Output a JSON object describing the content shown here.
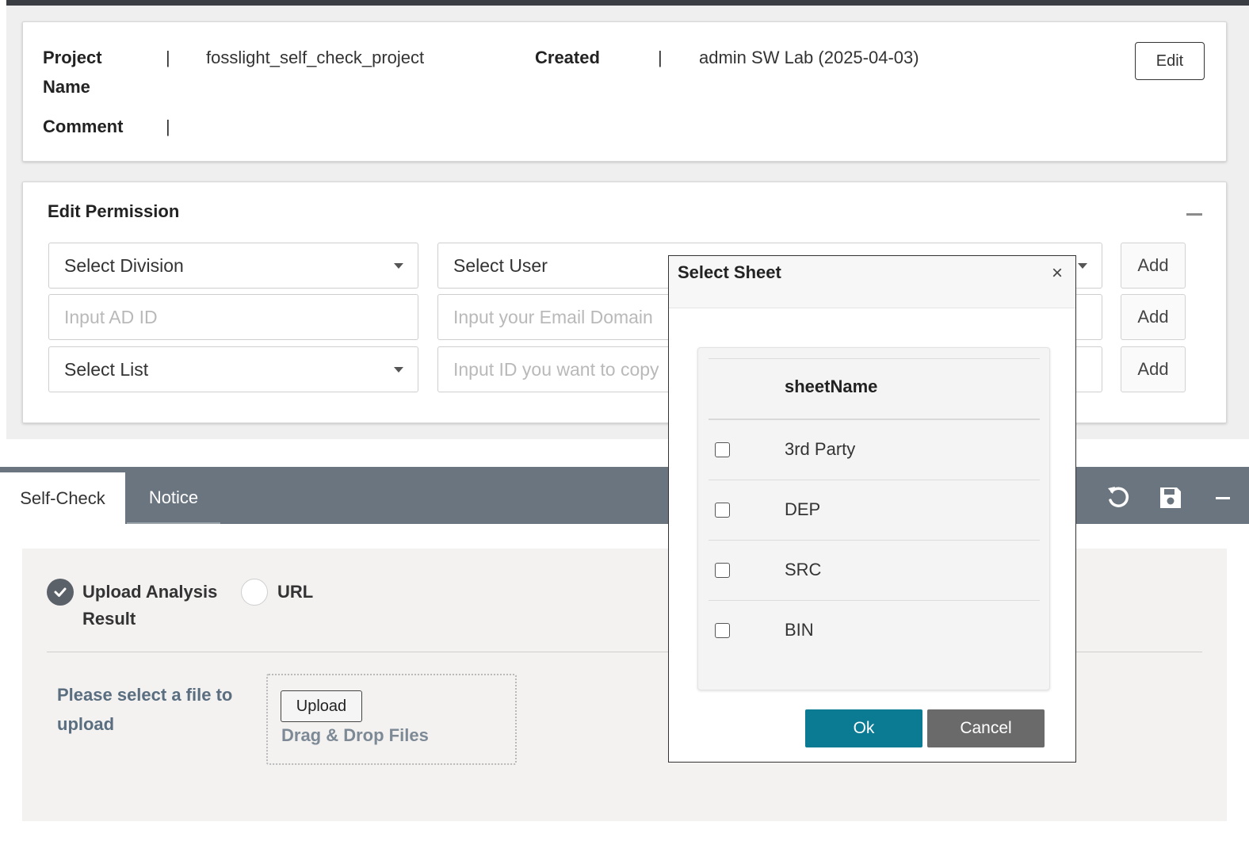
{
  "project": {
    "name_label": "Project Name",
    "name_value": "fosslight_self_check_project",
    "created_label": "Created",
    "created_value": "admin SW Lab (2025-04-03)",
    "comment_label": "Comment",
    "separator": "|",
    "edit_label": "Edit"
  },
  "permission": {
    "title": "Edit Permission",
    "select_division": "Select Division",
    "select_user": "Select User",
    "ad_id_placeholder": "Input AD ID",
    "email_domain_placeholder": "Input your Email Domain",
    "select_list": "Select List",
    "copy_id_placeholder": "Input ID you want to copy",
    "add_label": "Add"
  },
  "tabs": [
    {
      "label": "Self-Check",
      "active": true
    },
    {
      "label": "Notice",
      "active": false
    }
  ],
  "toolbar": {
    "icons": [
      "reset-icon",
      "save-icon",
      "minimize-icon"
    ]
  },
  "selfcheck": {
    "option_upload": "Upload Analysis Result",
    "option_url": "URL",
    "selected_option": "Upload Analysis Result",
    "select_file_text": "Please select a file to upload",
    "upload_label": "Upload",
    "drag_drop_text": "Drag & Drop Files"
  },
  "modal": {
    "title": "Select Sheet",
    "close": "×",
    "column_header": "sheetName",
    "sheets": [
      {
        "name": "3rd Party",
        "checked": false
      },
      {
        "name": "DEP",
        "checked": false
      },
      {
        "name": "SRC",
        "checked": false
      },
      {
        "name": "BIN",
        "checked": false
      }
    ],
    "ok_label": "Ok",
    "cancel_label": "Cancel"
  },
  "colors": {
    "tabbar": "#6b7580",
    "ok_button": "#0b7b94",
    "cancel_button": "#6a6a6a"
  }
}
